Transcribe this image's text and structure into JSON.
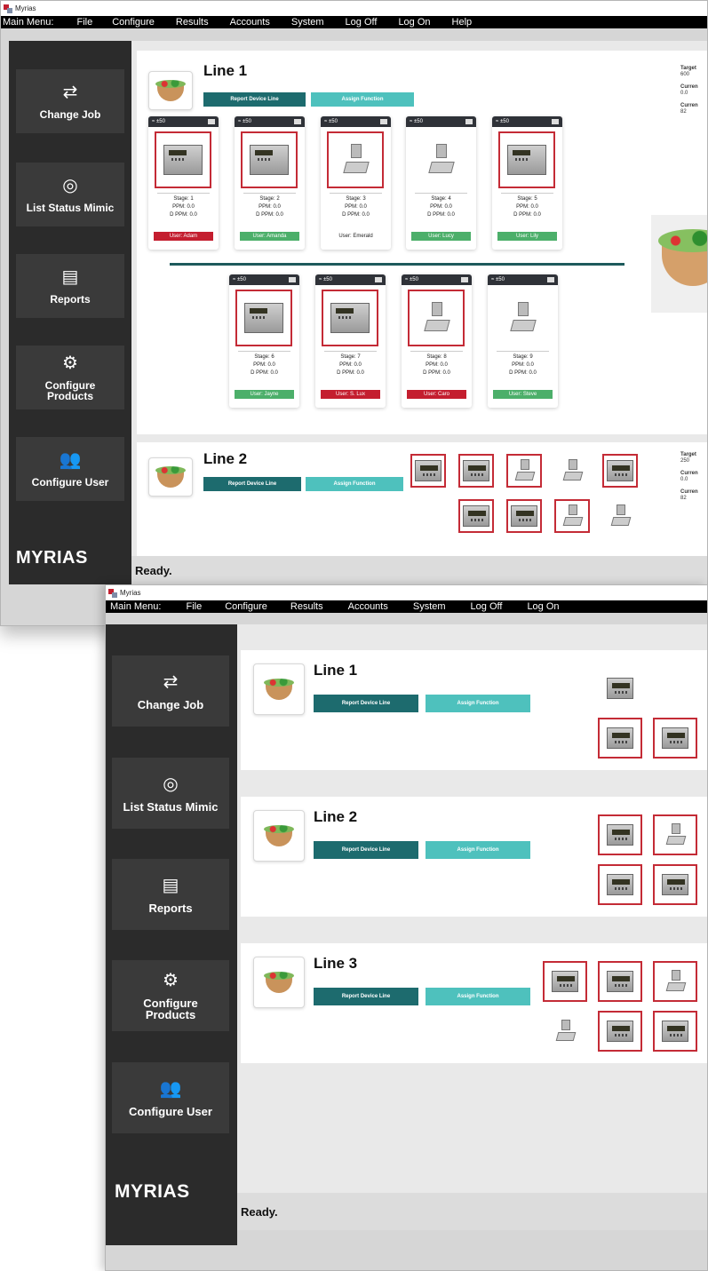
{
  "app_title": "Myrias",
  "menu": [
    "Main Menu:",
    "File",
    "Configure",
    "Results",
    "Accounts",
    "System",
    "Log Off",
    "Log On",
    "Help"
  ],
  "sidebar": [
    {
      "icon": "⇄",
      "label": "Change Job"
    },
    {
      "icon": "◎",
      "label": "List Status Mimic"
    },
    {
      "icon": "▤",
      "label": "Reports"
    },
    {
      "icon": "⚙",
      "label": "Configure Products"
    },
    {
      "icon": "👥",
      "label": "Configure User"
    }
  ],
  "logo": "MYRIAS",
  "status": "Ready.",
  "buttons": {
    "report": "Report Device Line",
    "assign": "Assign Function"
  },
  "win1": {
    "line1": {
      "title": "Line 1",
      "stats": {
        "target_label": "Target",
        "target": "600",
        "current_label_1": "Curren",
        "current_1": "0.0",
        "current_label_2": "Curren",
        "current_2": "82"
      },
      "cards": [
        {
          "head": "≈ ±50",
          "stage": "Stage: 1",
          "ppm": "PPM: 0.0",
          "dppm": "D PPM: 0.0",
          "user": "User: Adam",
          "user_color": "#c41e2f",
          "device": "indicator",
          "highlight": true
        },
        {
          "head": "≈ ±50",
          "stage": "Stage: 2",
          "ppm": "PPM: 0.0",
          "dppm": "D PPM: 0.0",
          "user": "User: Amanda",
          "user_color": "#4caf6a",
          "device": "indicator",
          "highlight": true
        },
        {
          "head": "≈ ±50",
          "stage": "Stage: 3",
          "ppm": "PPM: 0.0",
          "dppm": "D PPM: 0.0",
          "user": "User: Emerald",
          "user_color": "",
          "device": "platform",
          "highlight": true
        },
        {
          "head": "≈ ±50",
          "stage": "Stage: 4",
          "ppm": "PPM: 0.0",
          "dppm": "D PPM: 0.0",
          "user": "User: Lucy",
          "user_color": "#4caf6a",
          "device": "platform",
          "highlight": false
        },
        {
          "head": "≈ ±50",
          "stage": "Stage: 5",
          "ppm": "PPM: 0.0",
          "dppm": "D PPM: 0.0",
          "user": "User: Lily",
          "user_color": "#4caf6a",
          "device": "indicator",
          "highlight": true
        },
        {
          "head": "≈ ±50",
          "stage": "Stage: 6",
          "ppm": "PPM: 0.0",
          "dppm": "D PPM: 0.0",
          "user": "User: Jayne",
          "user_color": "#4caf6a",
          "device": "indicator",
          "highlight": true
        },
        {
          "head": "≈ ±50",
          "stage": "Stage: 7",
          "ppm": "PPM: 0.0",
          "dppm": "D PPM: 0.0",
          "user": "User: S. Lux",
          "user_color": "#c41e2f",
          "device": "indicator",
          "highlight": true
        },
        {
          "head": "≈ ±50",
          "stage": "Stage: 8",
          "ppm": "PPM: 0.0",
          "dppm": "D PPM: 0.0",
          "user": "User: Caro",
          "user_color": "#c41e2f",
          "device": "platform",
          "highlight": true
        },
        {
          "head": "≈ ±50",
          "stage": "Stage: 9",
          "ppm": "PPM: 0.0",
          "dppm": "D PPM: 0.0",
          "user": "User: Steve",
          "user_color": "#4caf6a",
          "device": "platform",
          "highlight": false
        }
      ]
    },
    "line2": {
      "title": "Line 2",
      "stats": {
        "target_label": "Target",
        "target": "250",
        "current_label_1": "Curren",
        "current_1": "0.0",
        "current_label_2": "Curren",
        "current_2": "82"
      },
      "devices_row1": [
        {
          "device": "indicator",
          "highlight": true
        },
        {
          "device": "indicator",
          "highlight": true
        },
        {
          "device": "platform",
          "highlight": true
        },
        {
          "device": "platform",
          "highlight": false
        },
        {
          "device": "indicator",
          "highlight": true
        }
      ],
      "devices_row2": [
        {
          "device": "indicator",
          "highlight": true
        },
        {
          "device": "indicator",
          "highlight": true
        },
        {
          "device": "platform",
          "highlight": true
        },
        {
          "device": "platform",
          "highlight": false
        }
      ]
    }
  },
  "win2": {
    "lines": [
      {
        "title": "Line 1",
        "row1": [
          {
            "device": "indicator",
            "highlight": false
          }
        ],
        "row2": [
          {
            "device": "indicator",
            "highlight": true
          },
          {
            "device": "indicator",
            "highlight": true
          },
          {
            "device": "indicator",
            "highlight": true
          }
        ]
      },
      {
        "title": "Line 2",
        "row1": [
          {
            "device": "indicator",
            "highlight": true
          },
          {
            "device": "platform",
            "highlight": true
          }
        ],
        "row2": [
          {
            "device": "indicator",
            "highlight": true
          },
          {
            "device": "indicator",
            "highlight": true
          },
          {
            "device": "indicator",
            "highlight": true
          }
        ]
      },
      {
        "title": "Line 3",
        "row1": [
          {
            "device": "indicator",
            "highlight": true
          },
          {
            "device": "indicator",
            "highlight": true
          },
          {
            "device": "platform",
            "highlight": true
          }
        ],
        "row2": [
          {
            "device": "platform",
            "highlight": false
          },
          {
            "device": "indicator",
            "highlight": true
          },
          {
            "device": "indicator",
            "highlight": true
          }
        ]
      }
    ]
  }
}
